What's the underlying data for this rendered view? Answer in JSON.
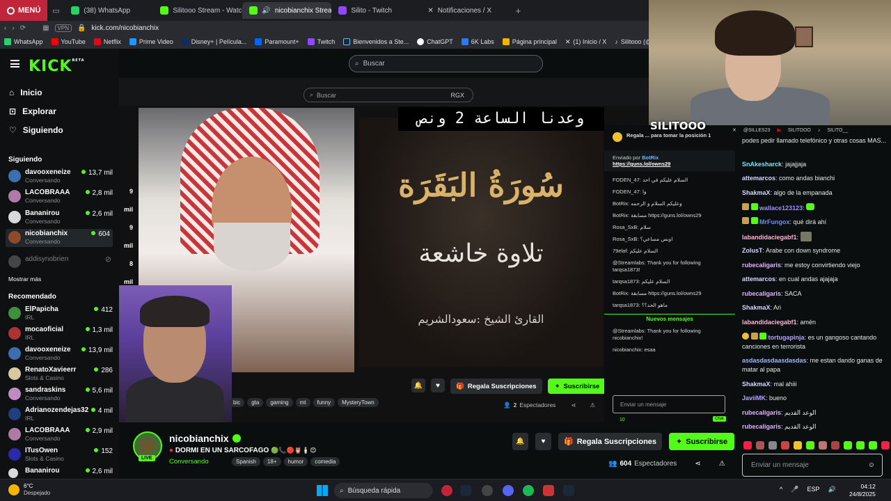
{
  "browser": {
    "menu_label": "MENÚ",
    "tabs": [
      {
        "title": "(38) WhatsApp",
        "color": "#25d366"
      },
      {
        "title": "Silitooo Stream - Watch L",
        "color": "#53fc18"
      },
      {
        "title": "nicobianchix Stream",
        "color": "#53fc18",
        "active": true
      },
      {
        "title": "Silito - Twitch",
        "color": "#9146ff"
      },
      {
        "title": "Notificaciones / X",
        "color": "#000000"
      }
    ],
    "new_tab": "+",
    "vpn": "VPN",
    "url": "kick.com/nicobianchix",
    "bookmarks": [
      {
        "label": "WhatsApp",
        "color": "#25d366"
      },
      {
        "label": "YouTube",
        "color": "#ff0000"
      },
      {
        "label": "Netflix",
        "color": "#e50914"
      },
      {
        "label": "Prime Video",
        "color": "#1a98ff"
      },
      {
        "label": "Disney+ | Película...",
        "color": "#0e2a67"
      },
      {
        "label": "Paramount+",
        "color": "#0064ff"
      },
      {
        "label": "Twitch",
        "color": "#9146ff"
      },
      {
        "label": "Bienvenidos a Ste...",
        "color": "#1b2838"
      },
      {
        "label": "ChatGPT",
        "color": "#ffffff"
      },
      {
        "label": "6K Labs",
        "color": "#2b7bf0"
      },
      {
        "label": "Página principal",
        "color": "#f4b400"
      },
      {
        "label": "(1) Inicio / X",
        "color": "#000000"
      },
      {
        "label": "Silitooo (@silito_...",
        "color": "#000000"
      }
    ]
  },
  "kick": {
    "logo": "KICK",
    "logo_badge": "BETA",
    "search_placeholder": "Buscar",
    "nav": [
      {
        "label": "Inicio",
        "icon": "home-icon"
      },
      {
        "label": "Explorar",
        "icon": "compass-icon"
      },
      {
        "label": "Siguiendo",
        "icon": "heart-icon"
      }
    ],
    "following_title": "Siguiendo",
    "following": [
      {
        "name": "davooxeneize",
        "category": "Conversando",
        "viewers": "13,7 mil",
        "color": "#3d6fb0"
      },
      {
        "name": "LACOBRAAA",
        "category": "Conversando",
        "viewers": "2,8 mil",
        "color": "#b07aa8"
      },
      {
        "name": "Bananirou",
        "category": "Conversando",
        "viewers": "2,6 mil",
        "color": "#d9d9d9"
      },
      {
        "name": "nicobianchix",
        "category": "Conversando",
        "viewers": "604",
        "color": "#8c4b2b",
        "selected": true
      }
    ],
    "offline_channel": "addisynobrien",
    "show_more": "Mostrar más",
    "recommended_title": "Recomendado",
    "recommended": [
      {
        "name": "ElPapicha",
        "category": "IRL",
        "viewers": "412",
        "color": "#3e8f3e"
      },
      {
        "name": "mocaoficial",
        "category": "IRL",
        "viewers": "1,3 mil",
        "color": "#a33"
      },
      {
        "name": "davooxeneize",
        "category": "Conversando",
        "viewers": "13,9 mil",
        "color": "#3d6fb0"
      },
      {
        "name": "RenatoXavieerr",
        "category": "Slots & Casino",
        "viewers": "286",
        "color": "#d8c8a0"
      },
      {
        "name": "sandraskins",
        "category": "Conversando",
        "viewers": "5,6 mil",
        "color": "#c08cc0"
      },
      {
        "name": "Adrianozendejas32",
        "category": "IRL",
        "viewers": "4 mil",
        "color": "#1f3f7f"
      },
      {
        "name": "LACOBRAAA",
        "category": "Conversando",
        "viewers": "2,9 mil",
        "color": "#b07aa8"
      },
      {
        "name": "ITusOwen",
        "category": "Slots & Casino",
        "viewers": "152",
        "color": "#2a2aa8"
      },
      {
        "name": "Bananirou",
        "category": "",
        "viewers": "2,6 mil",
        "color": "#d9d9d9"
      }
    ]
  },
  "video": {
    "inner_search": "Buscar",
    "inner_badge": "RGX",
    "overlay_text": "وعدنا الساعة 2 ونص",
    "surah_title": "سُورَةُ البَقَرَة",
    "recitation": "تلاوة خاشعة",
    "reciter": "القارئ الشيخ :سعودالشريم",
    "left_numbers": [
      "9 mil",
      "9 mil",
      "8 mil",
      "655",
      "586"
    ],
    "inner_tags": [
      "bic",
      "gta",
      "gaming",
      "mt",
      "funny",
      "MysteryTown"
    ],
    "inner_gift_label": "Regala Suscripciones",
    "inner_subscribe_label": "Suscribirse",
    "inner_viewers": "2",
    "inner_viewers_label": "Espectadores"
  },
  "inner_chat": {
    "pinned_text": "Regala ... para tomar la posición 1",
    "sent_by": "Enviado por",
    "sent_user": "BotRix",
    "link": "https://guns.lol/owns29",
    "messages": [
      "FODEN_47: السلام عليكم في احد",
      "FODEN_47: وا",
      "BotRix: وعليكم السلام و الرحمه",
      "BotRix: مسابقة https://guns.lol/owns29",
      "Rosa_SxB: سلام",
      "Rosa_SxB: اونص مساعي؟",
      "79elaf: السلام عليكم",
      "@Streamlabs: Thank you for following tarqsa1873!",
      "tarqsa1873: السلام عليكم",
      "BotRix: مسابقة https://guns.lol/owns29",
      "tarqsa1873: ماهو الحد؟؟"
    ],
    "new_messages": "Nuevos mensajes",
    "after": [
      "@Streamlabs: Thank you for following nicobianchix!",
      "nicobianchix: esaa"
    ],
    "input_placeholder": "Enviar un mensaje",
    "points": "10",
    "send": "Chat"
  },
  "channel": {
    "name": "nicobianchix",
    "live": "LIVE",
    "title": "DORMI EN UN SARCOFAGO",
    "category": "Conversando",
    "tags": [
      "Spanish",
      "18+",
      "humor",
      "comedia"
    ],
    "gift_label": "Regala Suscripciones",
    "subscribe_label": "Suscribirse",
    "viewers": "604",
    "viewers_label": "Espectadores"
  },
  "streamer_cam": {
    "overlay_name": "SILITOOO",
    "socials": [
      "@SILLES23",
      "SILITOOO",
      "SILITO__"
    ]
  },
  "chat": {
    "messages": [
      {
        "user": "",
        "text": "podes pedir llamado telefónico y otras cosas MAS...",
        "color": "#e8e9ea"
      },
      {
        "user": "SnAkesharck",
        "text": "jajajjaja",
        "color": "#6ee8ff"
      },
      {
        "user": "attemarcos",
        "text": "como andas bianchi",
        "color": "#d6d6ff"
      },
      {
        "user": "ShakmaX",
        "text": "algo de la empanada",
        "color": "#d6d6ff"
      },
      {
        "user": "wallace123123",
        "text": "",
        "color": "#9f8cff"
      },
      {
        "user": "MrFungox",
        "text": "qué dirá ahí",
        "color": "#6e8cff"
      },
      {
        "user": "labandidaciegabf1",
        "text": "",
        "color": "#ffb3d9"
      },
      {
        "user": "ZolusT",
        "text": "Arabe con down syndrome",
        "color": "#d6d6ff"
      },
      {
        "user": "rubecaligaris",
        "text": "me estoy convirtiendo viejo",
        "color": "#e0b3ff"
      },
      {
        "user": "attemarcos",
        "text": "en cual andas ajajaja",
        "color": "#d6d6ff"
      },
      {
        "user": "rubecaligaris",
        "text": "SACA",
        "color": "#e0b3ff"
      },
      {
        "user": "ShakmaX",
        "text": "Ari",
        "color": "#d6d6ff"
      },
      {
        "user": "labandidaciegabf1",
        "text": "amén",
        "color": "#ffb3d9"
      },
      {
        "user": "tortugapinja",
        "text": "es un gangoso cantando canciones en terrorista",
        "color": "#b3a4ff"
      },
      {
        "user": "asdasdasdaasdasdas",
        "text": "me estan dando ganas de matar al papa",
        "color": "#9fb8ff"
      },
      {
        "user": "ShakmaX",
        "text": "mal ahiii",
        "color": "#d6d6ff"
      },
      {
        "user": "JaviiMK",
        "text": "bueno",
        "color": "#b3a4ff"
      },
      {
        "user": "rubecaligaris",
        "text": "الوعد القديم",
        "color": "#e0b3ff"
      },
      {
        "user": "rubecaligaris",
        "text": "الوعد القديم",
        "color": "#e0b3ff"
      }
    ],
    "input_placeholder": "Enviar un mensaje"
  },
  "taskbar": {
    "weather_temp": "6°C",
    "weather_desc": "Despejado",
    "search_placeholder": "Búsqueda rápida",
    "lang": "ESP",
    "time": "04:12",
    "date": "24/8/2025"
  }
}
